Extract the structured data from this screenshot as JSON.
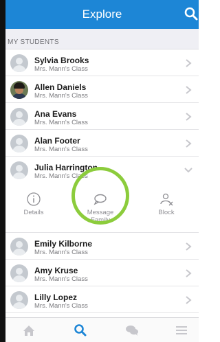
{
  "header": {
    "title": "Explore",
    "search_icon": "search-icon",
    "color": "#1d86d6"
  },
  "section": {
    "label": "MY STUDENTS"
  },
  "students": [
    {
      "name": "Sylvia Brooks",
      "class": "Mrs. Mann's Class",
      "expanded": false
    },
    {
      "name": "Allen Daniels",
      "class": "Mrs. Mann's Class",
      "expanded": false,
      "photo": true
    },
    {
      "name": "Ana Evans",
      "class": "Mrs. Mann's Class",
      "expanded": false
    },
    {
      "name": "Alan Footer",
      "class": "Mrs. Mann's Class",
      "expanded": false
    },
    {
      "name": "Julia Harrington",
      "class": "Mrs. Mann's Class",
      "expanded": true
    },
    {
      "name": "Emily Kilborne",
      "class": "Mrs. Mann's Class",
      "expanded": false
    },
    {
      "name": "Amy Kruse",
      "class": "Mrs. Mann's Class",
      "expanded": false
    },
    {
      "name": "Lilly Lopez",
      "class": "Mrs. Mann's Class",
      "expanded": false
    }
  ],
  "actions": {
    "details": {
      "label": "Details",
      "icon": "info-icon"
    },
    "message": {
      "label_line1": "Message",
      "label_line2": "Family",
      "icon": "chat-bubble-icon"
    },
    "block": {
      "label": "Block",
      "icon": "block-user-icon"
    }
  },
  "highlight_color": "#8ccc3c",
  "tabbar": {
    "items": [
      {
        "icon": "home-icon",
        "active": false
      },
      {
        "icon": "search-icon",
        "active": true
      },
      {
        "icon": "chat-icon",
        "active": false
      },
      {
        "icon": "menu-icon",
        "active": false
      }
    ],
    "active_color": "#1d86d6",
    "inactive_color": "#c7c7cc"
  }
}
